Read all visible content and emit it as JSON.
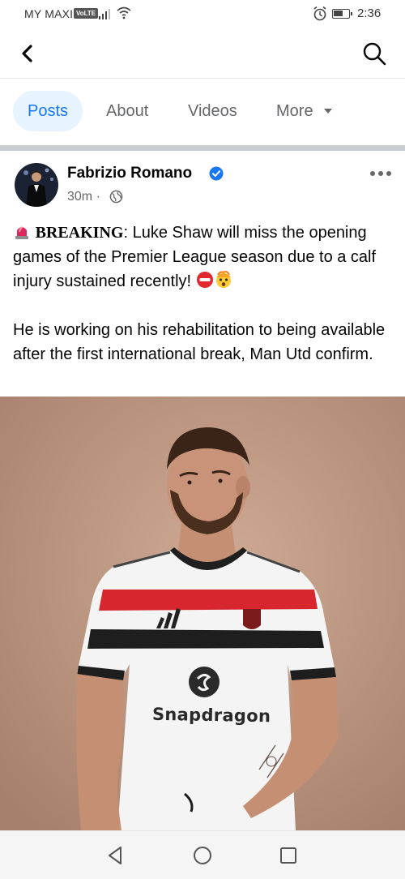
{
  "status_bar": {
    "carrier": "MY MAXIS",
    "volte": "VoLTE",
    "time": "2:36"
  },
  "header": {
    "back_icon": "chevron-left-icon",
    "search_icon": "search-icon"
  },
  "tabs": [
    {
      "label": "Posts",
      "active": true
    },
    {
      "label": "About",
      "active": false
    },
    {
      "label": "Videos",
      "active": false
    },
    {
      "label": "More",
      "active": false
    }
  ],
  "post": {
    "author": "Fabrizio Romano",
    "verified": true,
    "time": "30m",
    "audience_icon": "globe-icon",
    "breaking_label": "BREAKING",
    "line1": ": Luke Shaw will miss the opening games of the Premier League season due to a calf injury sustained recently!",
    "line2": "He is working on his rehabilitation to being available after the first international break, Man Utd confirm.",
    "image": {
      "shirt_sponsor": "Snapdragon"
    }
  },
  "colors": {
    "accent": "#1877f2",
    "tab_active_bg": "#e7f3ff",
    "secondary_text": "#65676b"
  }
}
